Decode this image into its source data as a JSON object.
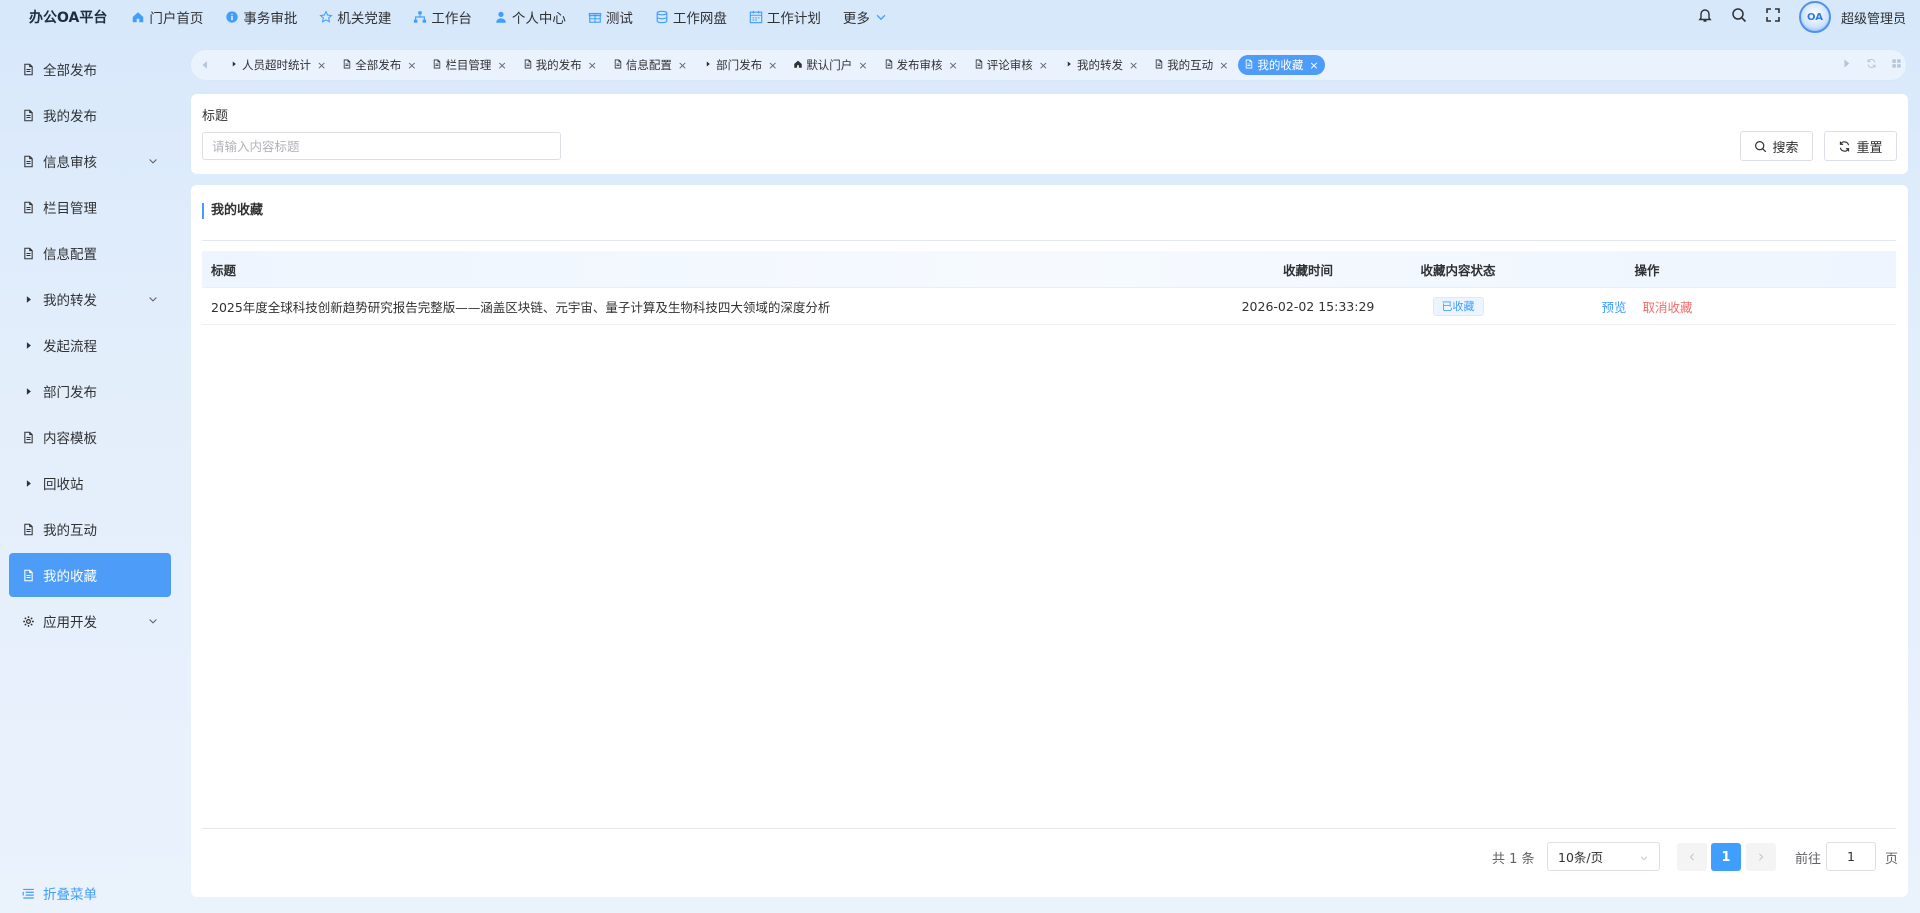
{
  "app": {
    "brand": "办公OA平台",
    "username": "超级管理员",
    "avatar_text": "OA"
  },
  "topnav": [
    {
      "label": "门户首页",
      "icon": "home-icon"
    },
    {
      "label": "事务审批",
      "icon": "info-circle-icon"
    },
    {
      "label": "机关党建",
      "icon": "star-icon"
    },
    {
      "label": "工作台",
      "icon": "sitemap-icon"
    },
    {
      "label": "个人中心",
      "icon": "user-icon"
    },
    {
      "label": "测试",
      "icon": "gift-icon"
    },
    {
      "label": "工作网盘",
      "icon": "database-icon"
    },
    {
      "label": "工作计划",
      "icon": "calendar-icon"
    },
    {
      "label": "更多",
      "icon": "chevron-down-icon"
    }
  ],
  "sidebar": {
    "items": [
      {
        "label": "全部发布",
        "icon": "document-icon",
        "expandable": false,
        "active": false
      },
      {
        "label": "我的发布",
        "icon": "document-icon",
        "expandable": false,
        "active": false
      },
      {
        "label": "信息审核",
        "icon": "document-icon",
        "expandable": true,
        "active": false
      },
      {
        "label": "栏目管理",
        "icon": "document-icon",
        "expandable": false,
        "active": false
      },
      {
        "label": "信息配置",
        "icon": "document-icon",
        "expandable": false,
        "active": false
      },
      {
        "label": "我的转发",
        "icon": "caret-right-icon",
        "expandable": true,
        "active": false
      },
      {
        "label": "发起流程",
        "icon": "caret-right-icon",
        "expandable": false,
        "active": false
      },
      {
        "label": "部门发布",
        "icon": "caret-right-icon",
        "expandable": false,
        "active": false
      },
      {
        "label": "内容模板",
        "icon": "document-icon",
        "expandable": false,
        "active": false
      },
      {
        "label": "回收站",
        "icon": "caret-right-icon",
        "expandable": false,
        "active": false
      },
      {
        "label": "我的互动",
        "icon": "document-icon",
        "expandable": false,
        "active": false
      },
      {
        "label": "我的收藏",
        "icon": "document-icon",
        "expandable": false,
        "active": true
      },
      {
        "label": "应用开发",
        "icon": "gear-icon",
        "expandable": true,
        "active": false
      }
    ],
    "collapse_label": "折叠菜单"
  },
  "tabs": [
    {
      "label": "人员超时统计",
      "icon": "caret-right-icon",
      "active": false
    },
    {
      "label": "全部发布",
      "icon": "document-icon",
      "active": false
    },
    {
      "label": "栏目管理",
      "icon": "document-icon",
      "active": false
    },
    {
      "label": "我的发布",
      "icon": "document-icon",
      "active": false
    },
    {
      "label": "信息配置",
      "icon": "document-icon",
      "active": false
    },
    {
      "label": "部门发布",
      "icon": "caret-right-icon",
      "active": false
    },
    {
      "label": "默认门户",
      "icon": "home-icon",
      "active": false
    },
    {
      "label": "发布审核",
      "icon": "document-icon",
      "active": false
    },
    {
      "label": "评论审核",
      "icon": "document-icon",
      "active": false
    },
    {
      "label": "我的转发",
      "icon": "caret-right-icon",
      "active": false
    },
    {
      "label": "我的互动",
      "icon": "document-icon",
      "active": false
    },
    {
      "label": "我的收藏",
      "icon": "document-icon",
      "active": true
    }
  ],
  "search": {
    "field_label": "标题",
    "placeholder": "请输入内容标题",
    "value": "",
    "search_label": "搜索",
    "reset_label": "重置"
  },
  "panel": {
    "title": "我的收藏",
    "columns": {
      "title": "标题",
      "time": "收藏时间",
      "status": "收藏内容状态",
      "actions": "操作"
    },
    "rows": [
      {
        "title": "2025年度全球科技创新趋势研究报告完整版——涵盖区块链、元宇宙、量子计算及生物科技四大领域的深度分析",
        "time": "2026-02-02 15:33:29",
        "status": "已收藏",
        "preview_label": "预览",
        "cancel_label": "取消收藏"
      }
    ]
  },
  "pagination": {
    "total_text": "共 1 条",
    "page_size": "10条/页",
    "current_page": "1",
    "goto_label": "前往",
    "goto_value": "1",
    "page_suffix": "页"
  },
  "colors": {
    "accent": "#409eff",
    "active_bg": "#4d9cf8",
    "danger": "#f56c6c"
  }
}
